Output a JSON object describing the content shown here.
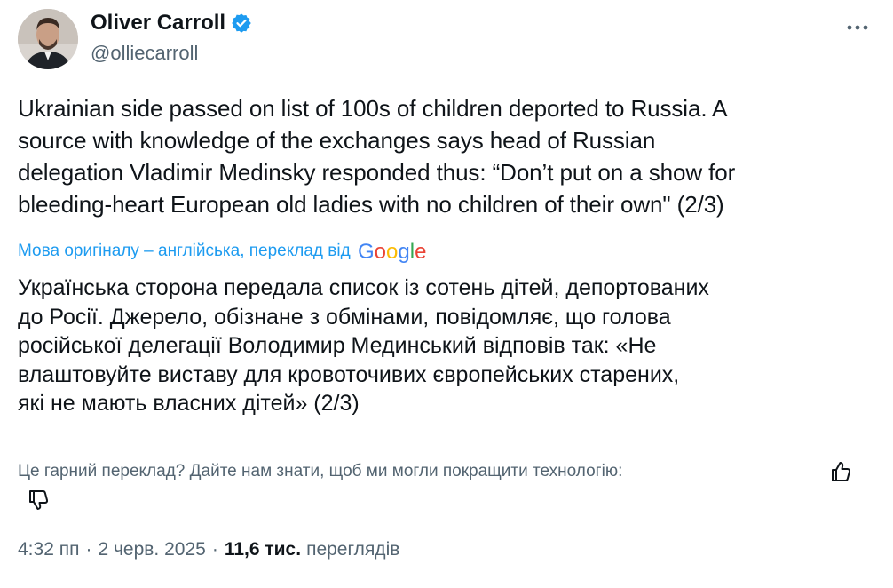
{
  "author": {
    "display_name": "Oliver Carroll",
    "handle": "@olliecarroll",
    "avatar_icon": "person-avatar",
    "verified_icon": "verified-badge-icon"
  },
  "colors": {
    "accent": "#1d9bf0",
    "text_primary": "#0f1419",
    "text_secondary": "#536471"
  },
  "tweet": {
    "text_lines": [
      "Ukrainian side passed on list of 100s of children deported to Russia. A",
      "source with knowledge of the exchanges says head of Russian",
      "delegation Vladimir Medinsky responded thus: “Don’t put on a show for",
      "bleeding-heart European old ladies with no children of their own\" (2/3)"
    ]
  },
  "translation": {
    "source_note": "Мова оригіналу – англійська, переклад від",
    "provider": "Google",
    "text_lines": [
      "Українська сторона передала список із сотень дітей, депортованих",
      "до Росії. Джерело, обізнане з обмінами, повідомляє, що голова",
      "російської делегації Володимир Мединський відповів так: «Не",
      "влаштовуйте виставу для кровоточивих європейських старених,",
      "які не мають власних дітей» (2/3)"
    ],
    "feedback_prompt": "Це гарний переклад? Дайте нам знати, щоб ми могли покращити технологію:"
  },
  "meta": {
    "time": "4:32 пп",
    "separator": "·",
    "date": "2 черв. 2025",
    "views_count": "11,6 тис.",
    "views_label": "переглядів"
  }
}
